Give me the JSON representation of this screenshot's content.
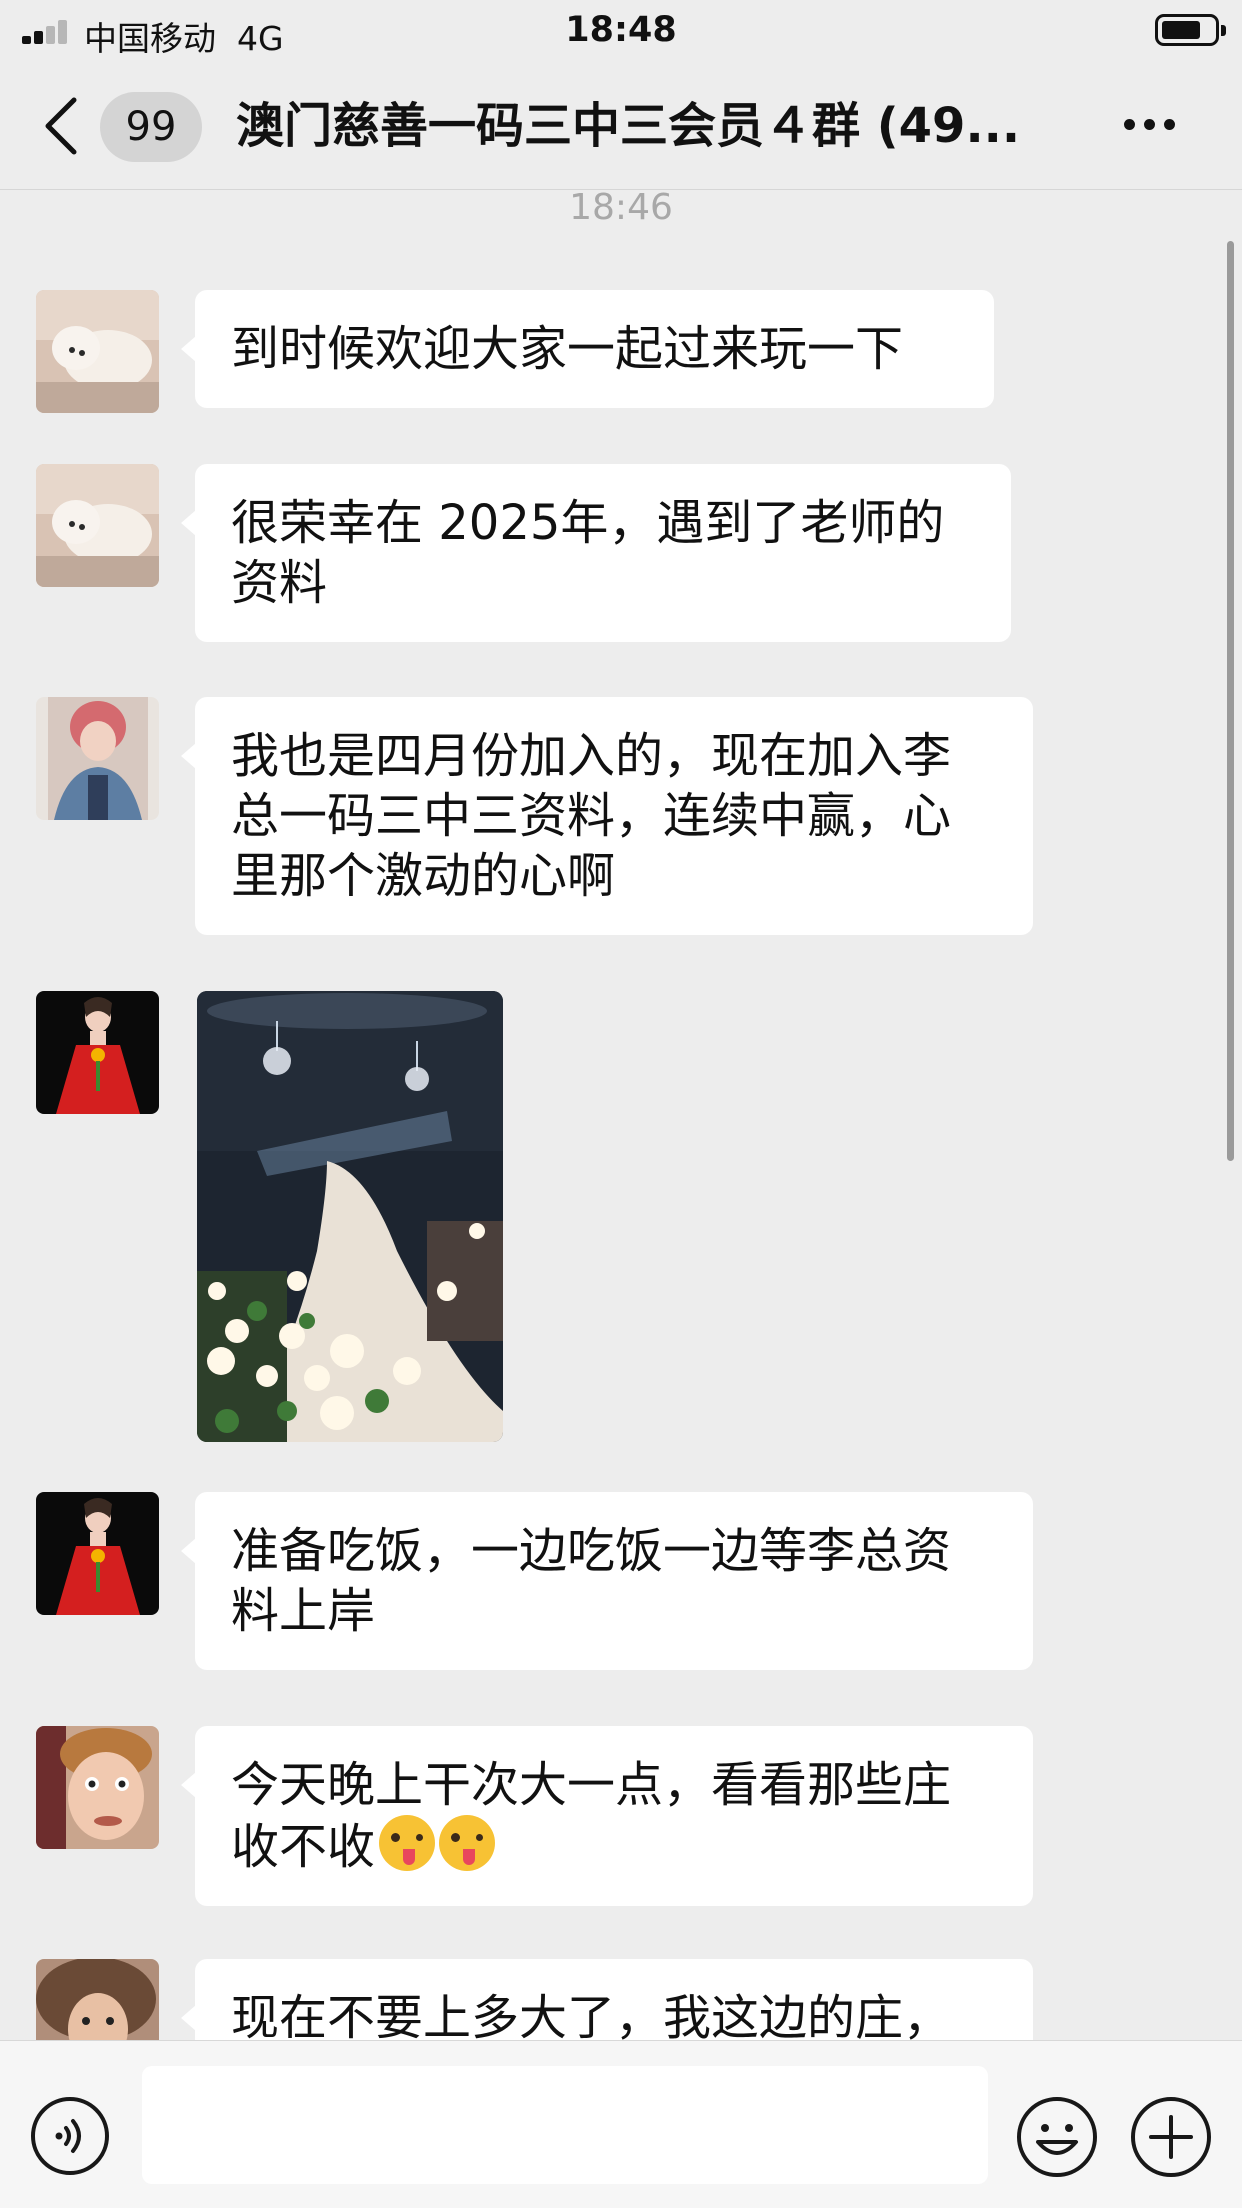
{
  "status_bar": {
    "carrier": "中国移动",
    "network": "4G",
    "time": "18:48"
  },
  "header": {
    "back_icon": "chevron-left-icon",
    "unread_count": "99",
    "title": "澳门慈善一码三中三会员４群 (49...",
    "more_icon": "more-horizontal-icon"
  },
  "chat": {
    "timestamp": "18:46",
    "messages": [
      {
        "type": "text",
        "avatar": "puppy-photo",
        "text": "到时候欢迎大家一起过来玩一下"
      },
      {
        "type": "text",
        "avatar": "puppy-photo",
        "text": "很荣幸在 2025年，遇到了老师的资料"
      },
      {
        "type": "text",
        "avatar": "woman-denim-jacket-photo",
        "text": "我也是四月份加入的，现在加入李总一码三中三资料，连续中赢，心里那个激动的心啊"
      },
      {
        "type": "image",
        "avatar": "woman-red-dress-photo",
        "image": "wedding-stage-photo"
      },
      {
        "type": "text",
        "avatar": "woman-red-dress-photo",
        "text": "准备吃饭，一边吃饭一边等李总资料上岸"
      },
      {
        "type": "text",
        "avatar": "boy-face-photo",
        "text": "今天晚上干次大一点，看看那些庄收不收",
        "emoji": [
          "winking-tongue-emoji",
          "winking-tongue-emoji"
        ]
      },
      {
        "type": "text",
        "avatar": "curly-hair-woman-photo",
        "text": "现在不要上多大了，我这边的庄，"
      }
    ]
  },
  "input_bar": {
    "voice_icon": "voice-icon",
    "text_value": "",
    "emoji_icon": "smiley-icon",
    "plus_icon": "plus-circle-icon"
  }
}
